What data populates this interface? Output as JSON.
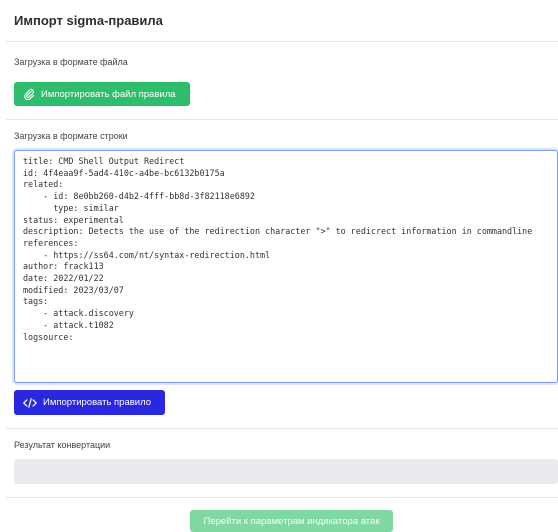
{
  "header": {
    "title": "Импорт sigma-правила"
  },
  "file_section": {
    "label": "Загрузка в формате файла",
    "import_button": "Импортировать файл правила",
    "import_icon": "paperclip-icon"
  },
  "string_section": {
    "label": "Загрузка в формате строки",
    "rule_text": "title: CMD Shell Output Redirect\nid: 4f4eaa9f-5ad4-410c-a4be-bc6132b0175a\nrelated:\n    - id: 8e0bb260-d4b2-4fff-bb8d-3f82118e6892\n      type: similar\nstatus: experimental\ndescription: Detects the use of the redirection character \">\" to redicrect information in commandline\nreferences:\n    - https://ss64.com/nt/syntax-redirection.html\nauthor: frack113\ndate: 2022/01/22\nmodified: 2023/03/07\ntags:\n    - attack.discovery\n    - attack.t1082\nlogsource:",
    "import_button": "Импортировать правило",
    "import_icon": "code-icon"
  },
  "result_section": {
    "label": "Результат конвертации",
    "value": ""
  },
  "footer": {
    "next_button": "Перейти к параметрам индикатора атак"
  },
  "colors": {
    "green": "#2ebd6b",
    "blue": "#2a27e0",
    "disabled_green": "#7fd8a0"
  }
}
